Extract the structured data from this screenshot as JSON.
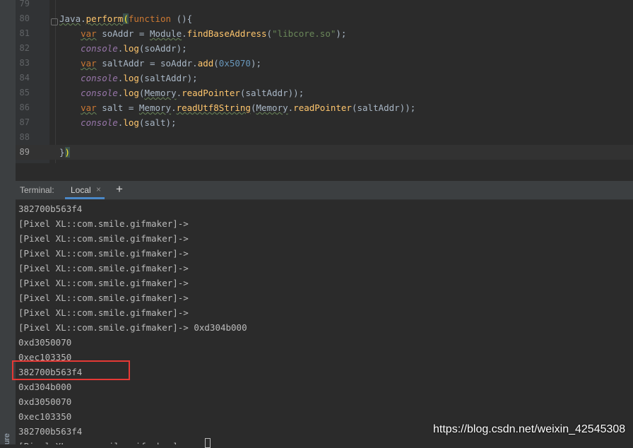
{
  "sidebar": {
    "structure_label": "ure"
  },
  "editor": {
    "line_numbers": [
      "79",
      "80",
      "81",
      "82",
      "83",
      "84",
      "85",
      "86",
      "87",
      "88",
      "89"
    ],
    "code": {
      "l80": {
        "t1": "Java",
        "t2": ".",
        "t3": "perform",
        "t4": "(",
        "t5": "function",
        "t6": " (){"
      },
      "l81": {
        "t1": "var",
        "t2": " soAddr = ",
        "t3": "Module",
        "t4": ".",
        "t5": "findBaseAddress",
        "t6": "(",
        "t7": "\"libcore.so\"",
        "t8": ");"
      },
      "l82": {
        "t1": "console",
        "t2": ".",
        "t3": "log",
        "t4": "(soAddr);"
      },
      "l83": {
        "t1": "var",
        "t2": " saltAddr = soAddr.",
        "t3": "add",
        "t4": "(",
        "t5": "0x5070",
        "t6": ");"
      },
      "l84": {
        "t1": "console",
        "t2": ".",
        "t3": "log",
        "t4": "(saltAddr);"
      },
      "l85": {
        "t1": "console",
        "t2": ".",
        "t3": "log",
        "t4": "(",
        "t5": "Memory",
        "t6": ".",
        "t7": "readPointer",
        "t8": "(saltAddr));"
      },
      "l86": {
        "t1": "var",
        "t2": " salt = ",
        "t3": "Memory",
        "t4": ".",
        "t5": "readUtf8String",
        "t6": "(",
        "t7": "Memory",
        "t8": ".",
        "t9": "readPointer",
        "t10": "(saltAddr));"
      },
      "l87": {
        "t1": "console",
        "t2": ".",
        "t3": "log",
        "t4": "(salt);"
      },
      "l89": {
        "t1": "}",
        "t2": ")"
      }
    }
  },
  "tool_window": {
    "title": "Terminal:",
    "tab_label": "Local",
    "close_glyph": "×",
    "add_glyph": "+"
  },
  "terminal": {
    "lines": [
      "382700b563f4",
      "[Pixel XL::com.smile.gifmaker]->",
      "[Pixel XL::com.smile.gifmaker]->",
      "[Pixel XL::com.smile.gifmaker]->",
      "[Pixel XL::com.smile.gifmaker]->",
      "[Pixel XL::com.smile.gifmaker]->",
      "[Pixel XL::com.smile.gifmaker]->",
      "[Pixel XL::com.smile.gifmaker]->",
      "[Pixel XL::com.smile.gifmaker]-> 0xd304b000",
      "0xd3050070",
      "0xec103350",
      "382700b563f4",
      "0xd304b000",
      "0xd3050070",
      "0xec103350",
      "382700b563f4",
      "[Pixel XL::com.smile.gifmaker]-> "
    ]
  },
  "watermark": "https://blog.csdn.net/weixin_42545308"
}
